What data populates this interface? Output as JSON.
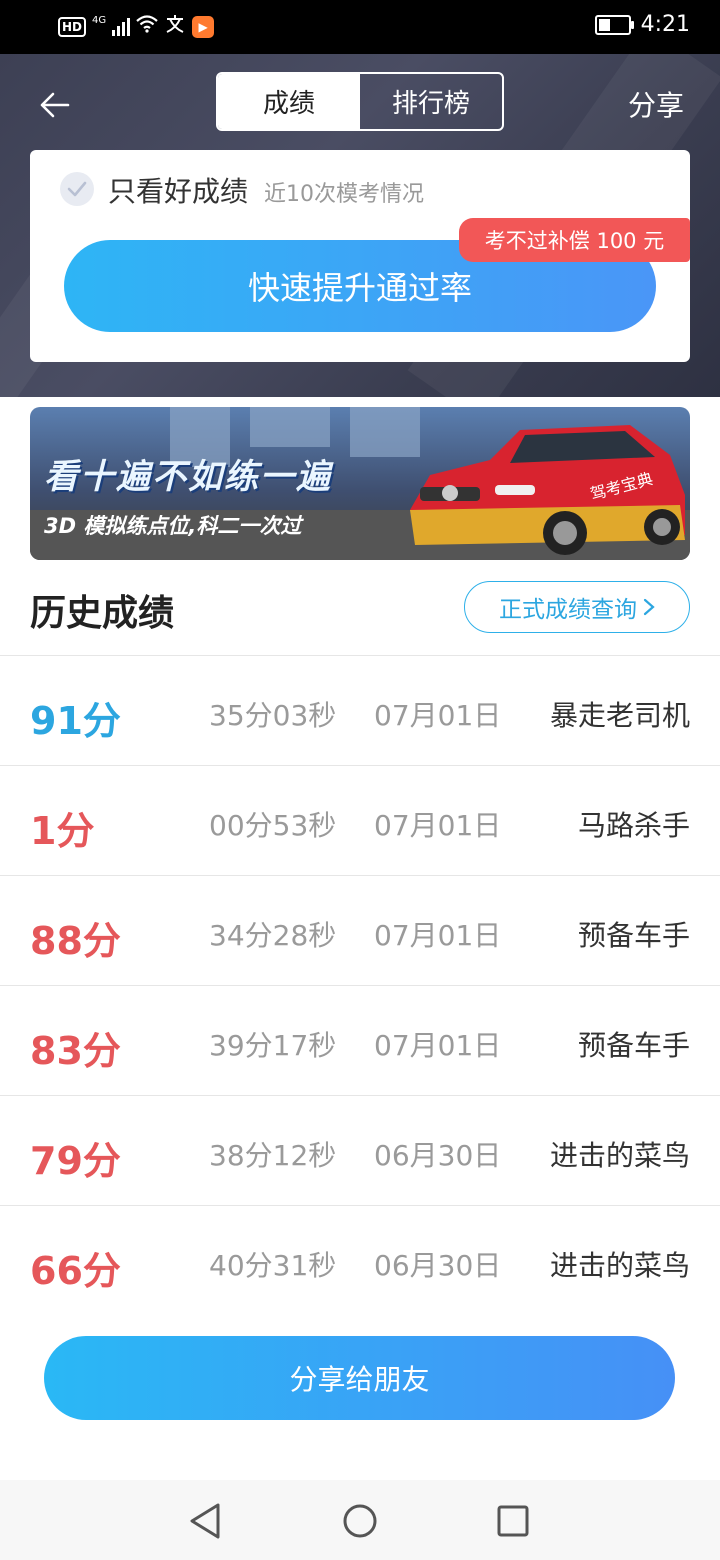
{
  "status_bar": {
    "time": "4:21",
    "hd": "HD",
    "network": "4G",
    "battery_level": 0.4,
    "icons": [
      "hd-icon",
      "signal-icon",
      "wifi-icon",
      "wen-icon",
      "play-app-icon",
      "battery-icon"
    ]
  },
  "header": {
    "tabs": [
      {
        "label": "成绩",
        "active": true
      },
      {
        "label": "排行榜",
        "active": false
      }
    ],
    "share_label": "分享"
  },
  "card": {
    "filter_label": "只看好成绩",
    "filter_sub": "近10次模考情况",
    "filter_checked": true,
    "badge": "考不过补偿 100 元",
    "cta_label": "快速提升通过率"
  },
  "banner": {
    "line1": "看十遍不如练一遍",
    "line2": "3D 模拟练点位,科二一次过",
    "car_brand": "驾考宝典"
  },
  "history": {
    "title": "历史成绩",
    "official_btn": "正式成绩查询",
    "rows": [
      {
        "score": "91分",
        "duration": "35分03秒",
        "date": "07月01日",
        "title": "暴走老司机",
        "color": "#2ca6e0"
      },
      {
        "score": "1分",
        "duration": "00分53秒",
        "date": "07月01日",
        "title": "马路杀手",
        "color": "#e5575a"
      },
      {
        "score": "88分",
        "duration": "34分28秒",
        "date": "07月01日",
        "title": "预备车手",
        "color": "#e5575a"
      },
      {
        "score": "83分",
        "duration": "39分17秒",
        "date": "07月01日",
        "title": "预备车手",
        "color": "#e5575a"
      },
      {
        "score": "79分",
        "duration": "38分12秒",
        "date": "06月30日",
        "title": "进击的菜鸟",
        "color": "#e5575a"
      },
      {
        "score": "66分",
        "duration": "40分31秒",
        "date": "06月30日",
        "title": "进击的菜鸟",
        "color": "#e5575a"
      }
    ]
  },
  "share_button": "分享给朋友",
  "colors": {
    "accent": "#2eb5f5",
    "danger": "#e5575a",
    "header_bg": "#3d4054"
  }
}
